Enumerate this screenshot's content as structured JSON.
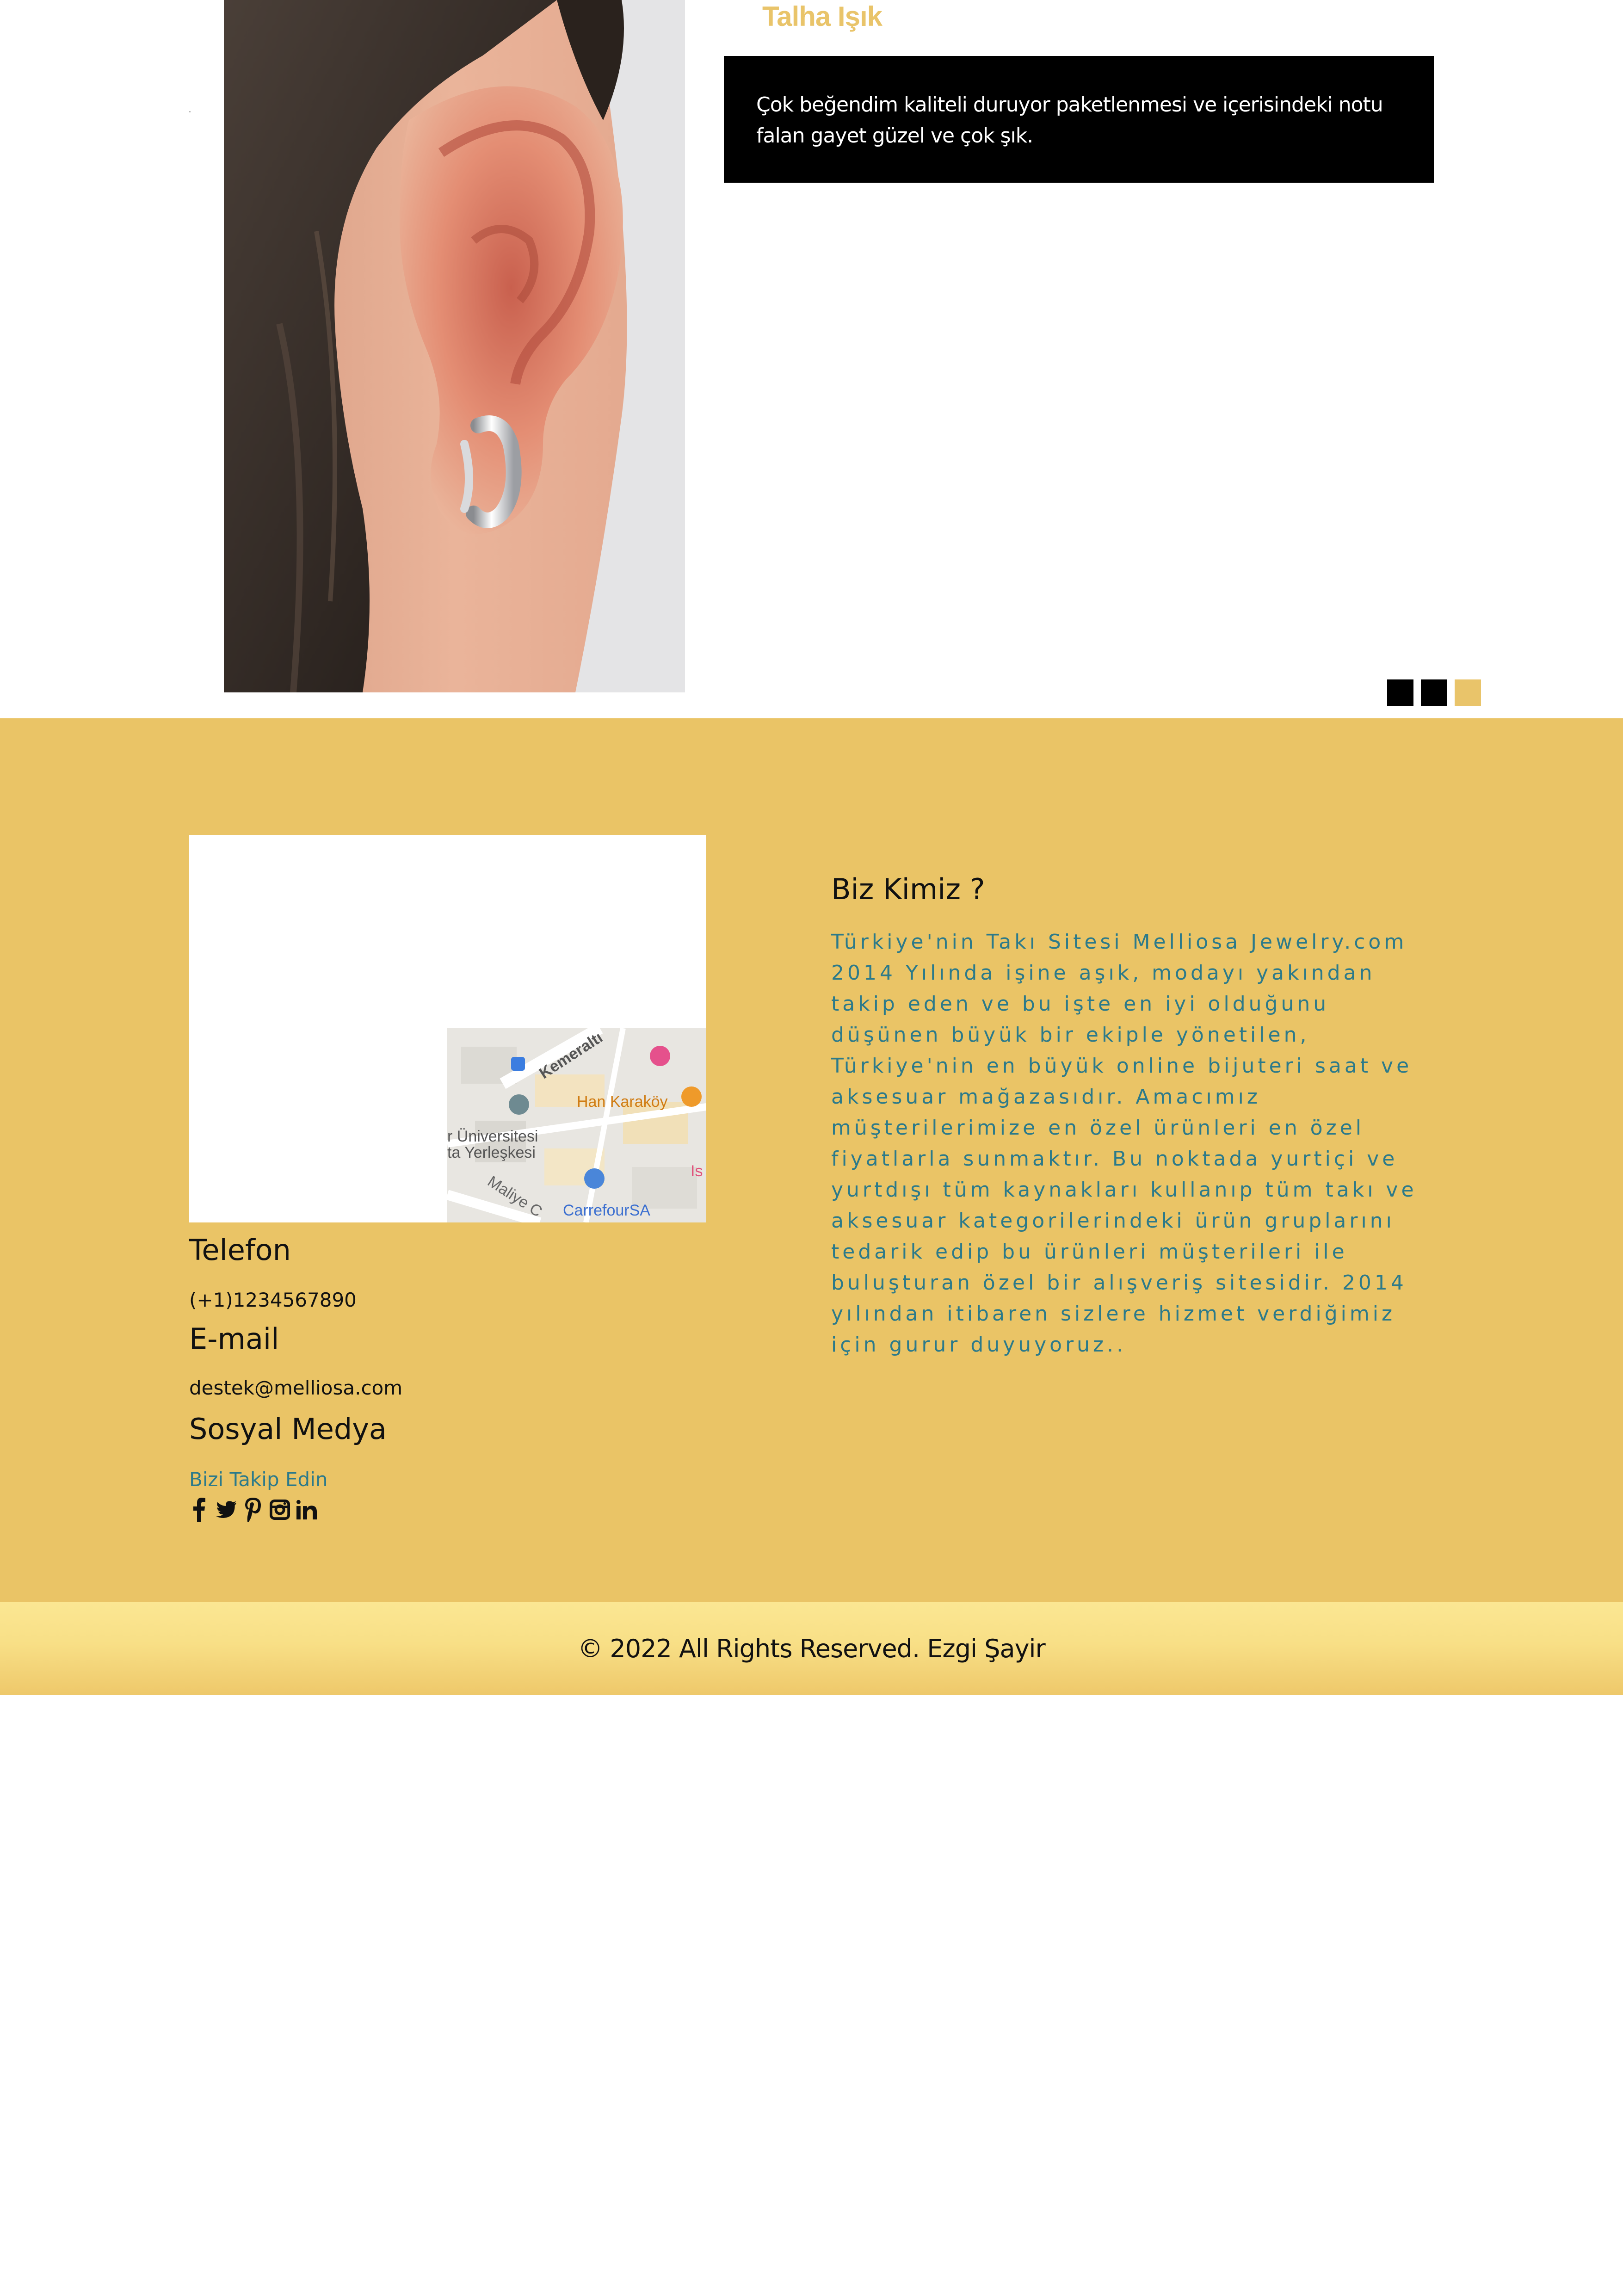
{
  "testimonial": {
    "author": "Talha Işık",
    "quote": "Çok beğendim kaliteli duruyor paketlenmesi ve içerisindeki notu falan gayet güzel ve çok şık.",
    "slide_count": 3,
    "active_slide": 3,
    "photo_subject": "ear-with-silver-hoop-earring"
  },
  "footer": {
    "map": {
      "labels": [
        "Kemeraltı",
        "Han Karaköy",
        "r Üniversitesi",
        "ta Yerleşkesi",
        "Maliye C",
        "CarrefourSA",
        "Is"
      ]
    },
    "phone_heading": "Telefon",
    "phone": "(+1)1234567890",
    "email_heading": "E-mail",
    "email": "destek@melliosa.com",
    "social_heading": "Sosyal Medya",
    "follow_text": "Bizi Takip Edin",
    "social_icons": [
      "facebook-icon",
      "twitter-icon",
      "pinterest-icon",
      "instagram-icon",
      "linkedin-icon"
    ],
    "about_title": "Biz Kimiz ?",
    "about_text": "Türkiye'nin Takı Sitesi Melliosa Jewelry.com 2014 Yılında işine aşık, modayı yakından takip eden ve bu işte en iyi olduğunu düşünen büyük bir ekiple yönetilen, Türkiye'nin en büyük online bijuteri saat ve aksesuar mağazasıdır. Amacımız müşterilerimize en özel ürünleri en özel fiyatlarla sunmaktır. Bu noktada yurtiçi ve yurtdışı tüm kaynakları kullanıp tüm takı ve aksesuar kategorilerindeki ürün gruplarını tedarik edip bu ürünleri müşterileri ile buluşturan özel bir alışveriş sitesidir. 2014 yılından itibaren sizlere hizmet verdiğimiz için gurur duyuyoruz.."
  },
  "copyright": "© 2022 All Rights Reserved. Ezgi Şayir",
  "colors": {
    "accent": "#e9c46a",
    "footer_bg": "#eac466",
    "link_teal": "#2c7a8a",
    "dark": "#000000"
  }
}
